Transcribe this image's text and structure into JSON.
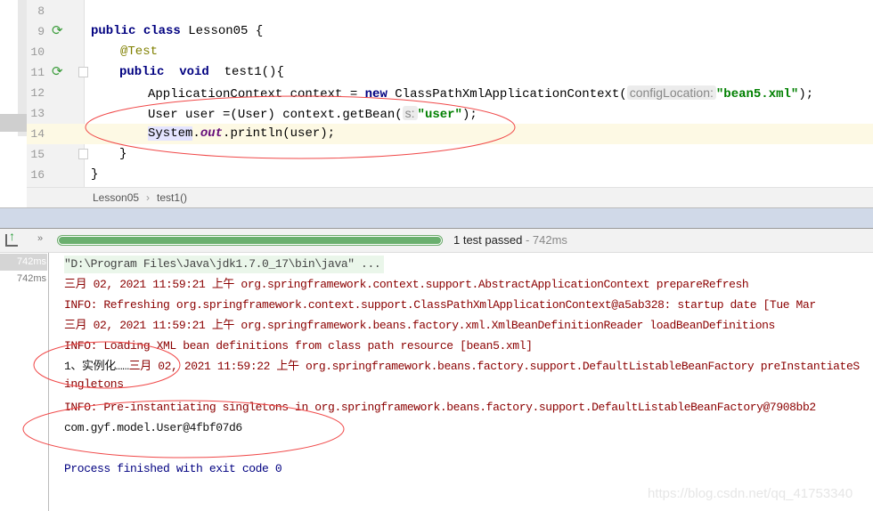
{
  "editor": {
    "lines": [
      {
        "n": "8"
      },
      {
        "n": "9",
        "t": [
          "public",
          " class",
          " Lesson05 {"
        ]
      },
      {
        "n": "10",
        "t": [
          "@Test"
        ]
      },
      {
        "n": "11",
        "t": [
          "public",
          "  void",
          "  test1(){"
        ]
      },
      {
        "n": "12",
        "t": [
          "ApplicationContext context = ",
          "new",
          " ClassPathXmlApplicationContext(",
          "configLocation:",
          "\"bean5.xml\"",
          ");"
        ]
      },
      {
        "n": "13",
        "t": [
          "User user =(User) context.getBean(",
          "s:",
          "\"user\"",
          ");"
        ]
      },
      {
        "n": "14",
        "t": [
          "System",
          ".",
          "out",
          ".println(user);"
        ]
      },
      {
        "n": "15",
        "t": [
          "}"
        ]
      },
      {
        "n": "16",
        "t": [
          "}"
        ]
      }
    ],
    "breadcrumb": [
      "Lesson05",
      "test1()"
    ]
  },
  "run": {
    "status": "1 test passed",
    "duration": "- 742ms",
    "progress": 100,
    "times": [
      "742ms",
      "742ms"
    ],
    "console": [
      "\"D:\\Program Files\\Java\\jdk1.7.0_17\\bin\\java\" ...",
      "三月 02, 2021 11:59:21 上午 org.springframework.context.support.AbstractApplicationContext prepareRefresh",
      "INFO: Refreshing org.springframework.context.support.ClassPathXmlApplicationContext@a5ab328: startup date [Tue Mar",
      "三月 02, 2021 11:59:21 上午 org.springframework.beans.factory.xml.XmlBeanDefinitionReader loadBeanDefinitions",
      "INFO: Loading XML bean definitions from class path resource [bean5.xml]",
      "1、实例化……",
      "三月 02, 2021 11:59:22 上午 org.springframework.beans.factory.support.DefaultListableBeanFactory preInstantiateSingletons",
      "INFO: Pre-instantiating singletons in org.springframework.beans.factory.support.DefaultListableBeanFactory@7908bb2",
      "com.gyf.model.User@4fbf07d6",
      "Process finished with exit code 0"
    ]
  },
  "watermark": "https://blog.csdn.net/qq_41753340",
  "colors": {
    "annotation": "#ff0000",
    "progress": "#6aaf6e"
  }
}
